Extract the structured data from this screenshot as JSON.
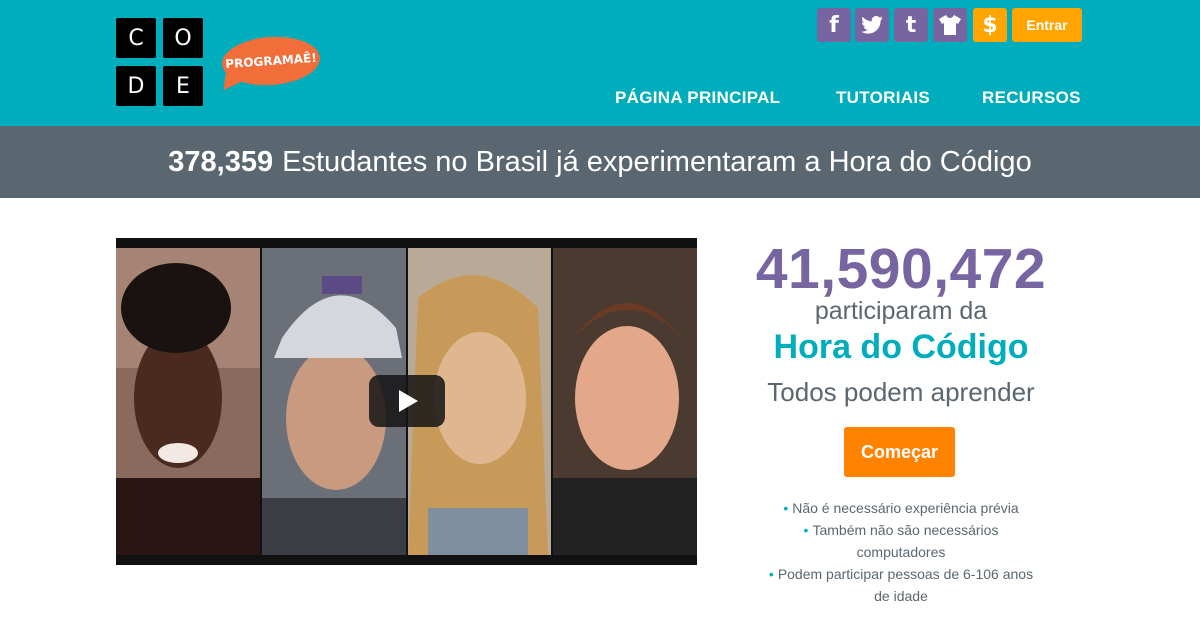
{
  "logo": {
    "letters": [
      "C",
      "O",
      "D",
      "E"
    ],
    "badge": "PROGRAMAÊ!"
  },
  "social": [
    {
      "icon": "facebook-icon",
      "glyph": "f"
    },
    {
      "icon": "twitter-icon",
      "glyph": "🐦"
    },
    {
      "icon": "tumblr-icon",
      "glyph": "t"
    },
    {
      "icon": "shirt-icon",
      "glyph": "👕"
    },
    {
      "icon": "dollar-icon",
      "glyph": "$"
    }
  ],
  "login": {
    "label": "Entrar"
  },
  "nav": {
    "home": "PÁGINA PRINCIPAL",
    "tutorials": "TUTORIAIS",
    "resources": "RECURSOS"
  },
  "banner": {
    "count": "378,359",
    "text": "Estudantes no Brasil já experimentaram a Hora do Código"
  },
  "hero": {
    "count": "41,590,472",
    "participated": "participaram da",
    "event": "Hora do Código",
    "tagline": "Todos podem aprender",
    "start": "Começar",
    "bullets": [
      "Não é necessário experiência prévia",
      "Também não são necessários computadores",
      "Podem participar pessoas de 6-106 anos de idade"
    ]
  },
  "colors": {
    "header": "#00adbc",
    "banner": "#5b6770",
    "purple": "#7665a0",
    "orange": "#ff8200",
    "accent": "#ffa400"
  }
}
